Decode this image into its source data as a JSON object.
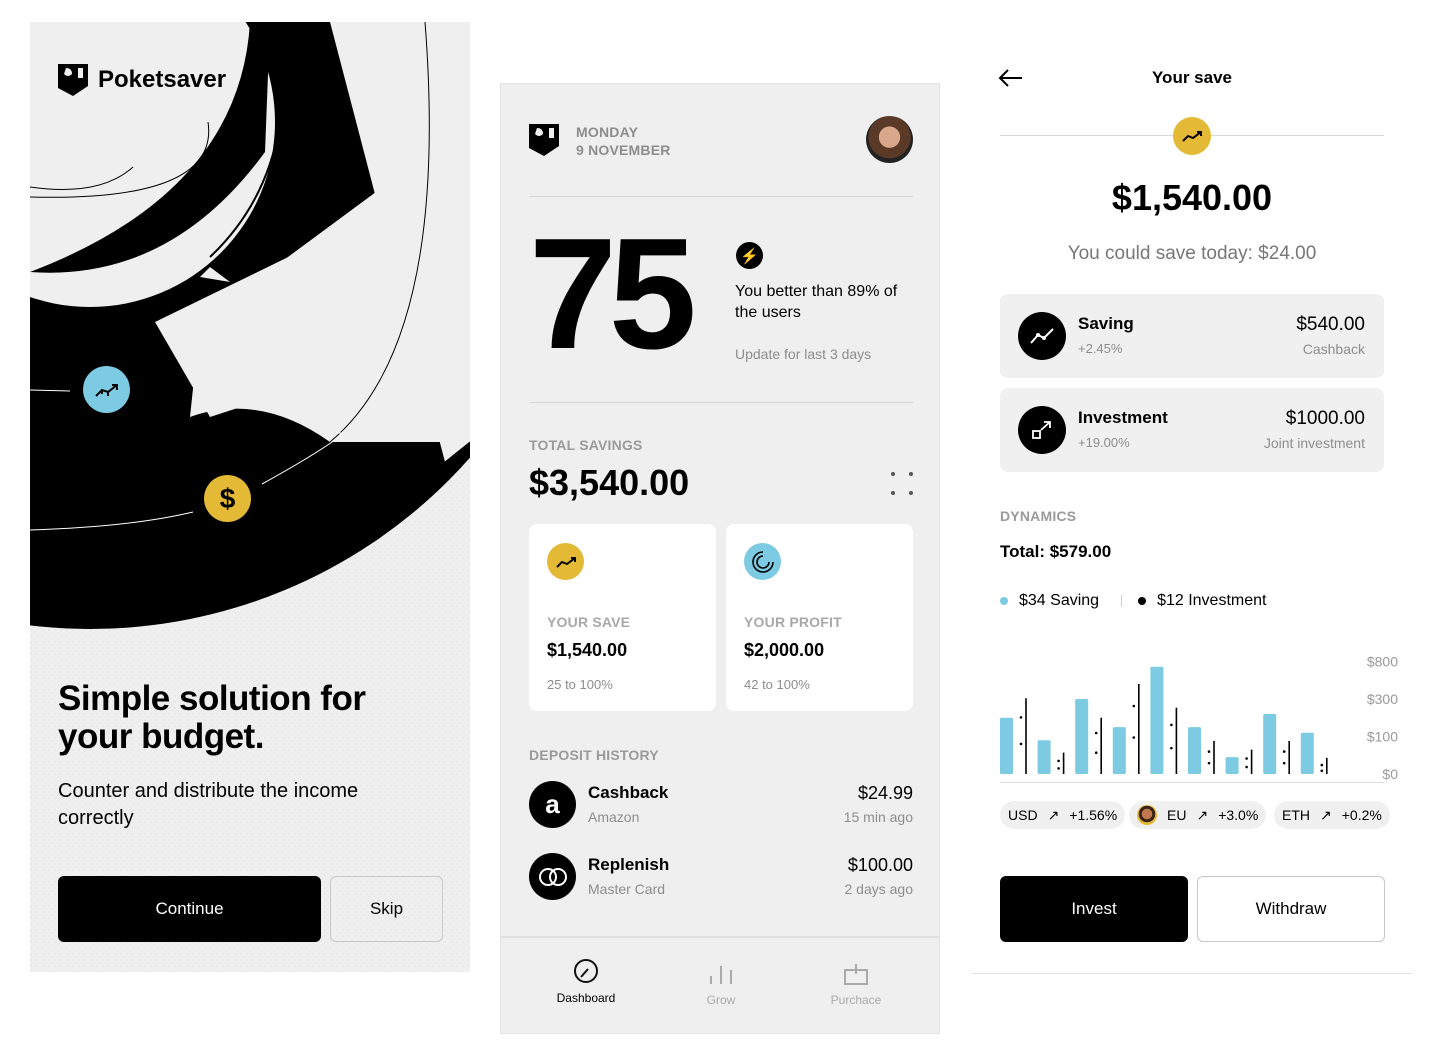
{
  "onboarding": {
    "brand": "Poketsaver",
    "headline": "Simple solution for your budget.",
    "subtext": "Counter and distribute the income correctly",
    "continue_label": "Continue",
    "skip_label": "Skip",
    "colors": {
      "blue": "#7ccbe2",
      "yellow": "#e4b935"
    }
  },
  "dashboard": {
    "day": "MONDAY",
    "date": "9 NOVEMBER",
    "score": "75",
    "score_text": "You better than 89% of the users",
    "update_text": "Update for last 3 days",
    "total_label": "TOTAL SAVINGS",
    "total_value": "$3,540.00",
    "cards": [
      {
        "label": "YOUR SAVE",
        "value": "$1,540.00",
        "range": "25 to 100%",
        "icon": "trend-up-icon"
      },
      {
        "label": "YOUR PROFIT",
        "value": "$2,000.00",
        "range": "42 to 100%",
        "icon": "spiral-icon"
      }
    ],
    "history_label": "DEPOSIT HISTORY",
    "history": [
      {
        "title": "Cashback",
        "sub": "Amazon",
        "amount": "$24.99",
        "time": "15 min ago",
        "icon": "amazon-icon"
      },
      {
        "title": "Replenish",
        "sub": "Master Card",
        "amount": "$100.00",
        "time": "2 days ago",
        "icon": "mastercard-icon"
      }
    ],
    "nav": [
      {
        "label": "Dashboard",
        "icon": "gauge-icon",
        "active": true
      },
      {
        "label": "Grow",
        "icon": "bars-icon",
        "active": false
      },
      {
        "label": "Purchace",
        "icon": "box-icon",
        "active": false
      }
    ]
  },
  "save": {
    "title": "Your save",
    "amount": "$1,540.00",
    "could_save": "You could save today: $24.00",
    "items": [
      {
        "title": "Saving",
        "change": "+2.45%",
        "amount": "$540.00",
        "sub": "Cashback",
        "icon": "trend-icon"
      },
      {
        "title": "Investment",
        "change": "+19.00%",
        "amount": "$1000.00",
        "sub": "Joint investment",
        "icon": "expand-icon"
      }
    ],
    "dynamics_label": "DYNAMICS",
    "total": "Total: $579.00",
    "currencies": [
      {
        "code": "USD",
        "change": "+1.56%"
      },
      {
        "code": "EU",
        "change": "+3.0%"
      },
      {
        "code": "ETH",
        "change": "+0.2%"
      }
    ],
    "invest_label": "Invest",
    "withdraw_label": "Withdraw"
  },
  "chart_data": {
    "type": "bar",
    "legend": [
      "$34 Saving",
      "$12 Investment"
    ],
    "legend_placement": "top-left",
    "y_ticks": [
      "$800",
      "$300",
      "$100",
      "$0"
    ],
    "y_tick_values": [
      800,
      300,
      100,
      0
    ],
    "series": [
      {
        "name": "$34 Saving",
        "color": "#7ccbe2",
        "values": [
          200,
          90,
          300,
          150,
          730,
          150,
          45,
          220,
          120
        ]
      },
      {
        "name": "$12 Investment",
        "color": "#000000",
        "values": [
          310,
          57,
          200,
          500,
          254,
          88,
          65,
          88,
          43
        ]
      }
    ]
  }
}
